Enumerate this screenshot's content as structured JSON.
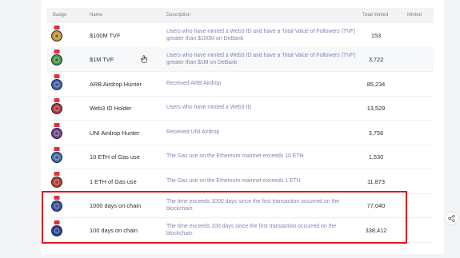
{
  "table": {
    "headers": {
      "badge": "Badge",
      "name": "Name",
      "description": "Description",
      "total_minted": "Total minted",
      "minted": "Minted"
    },
    "rows": [
      {
        "name": "$100M TVF",
        "description": "Users who have minted a Web3 ID and have a Total Value of Followers (TVF) greater than $100M on DeBank",
        "total_minted": "153",
        "badge_icon": "tvf-100m-badge-icon",
        "badge_color": "#c9962a"
      },
      {
        "name": "$1M TVF",
        "description": "Users who have minted a Web3 ID and have a Total Value of Followers (TVF) greater than $1M on DeBank",
        "total_minted": "3,722",
        "badge_icon": "tvf-1m-badge-icon",
        "badge_color": "#4a9a3c"
      },
      {
        "name": "ARB Airdrop Hunter",
        "description": "Received ARB Airdrop",
        "total_minted": "85,234",
        "badge_icon": "arb-badge-icon",
        "badge_color": "#3e5fa8"
      },
      {
        "name": "Web3 ID Holder",
        "description": "Users who have minted a Web3 ID",
        "total_minted": "13,529",
        "badge_icon": "web3-id-badge-icon",
        "badge_color": "#b5333a"
      },
      {
        "name": "UNI Airdrop Hunter",
        "description": "Received UNI Airdrop",
        "total_minted": "3,756",
        "badge_icon": "uni-badge-icon",
        "badge_color": "#7a3a8c"
      },
      {
        "name": "10 ETH of Gas use",
        "description": "The Gas use on the Ethereum mainnet exceeds 10 ETH",
        "total_minted": "1,530",
        "badge_icon": "gas-10-eth-badge-icon",
        "badge_color": "#3b6fb0"
      },
      {
        "name": "1 ETH of Gas use",
        "description": "The Gas use on the Ethereum mainnet exceeds 1 ETH",
        "total_minted": "11,873",
        "badge_icon": "gas-1-eth-badge-icon",
        "badge_color": "#c0392b"
      },
      {
        "name": "1000 days on chain",
        "description": "The time exceeds 1000 days since the first transaction occurred on the blockchain",
        "total_minted": "77,040",
        "badge_icon": "days-1000-badge-icon",
        "badge_color": "#3a4aa0"
      },
      {
        "name": "100 days on chain",
        "description": "The time exceeds 100 days since the first transaction occurred on the blockchain",
        "total_minted": "338,412",
        "badge_icon": "days-100-badge-icon",
        "badge_color": "#2b3f8c"
      }
    ]
  },
  "colors": {
    "highlight_border": "#e0141e",
    "description_text": "#7d86b3",
    "badge_ribbon": "#d9343a"
  },
  "icons": {
    "cursor": "hand-pointer-icon",
    "share": "share-icon"
  }
}
